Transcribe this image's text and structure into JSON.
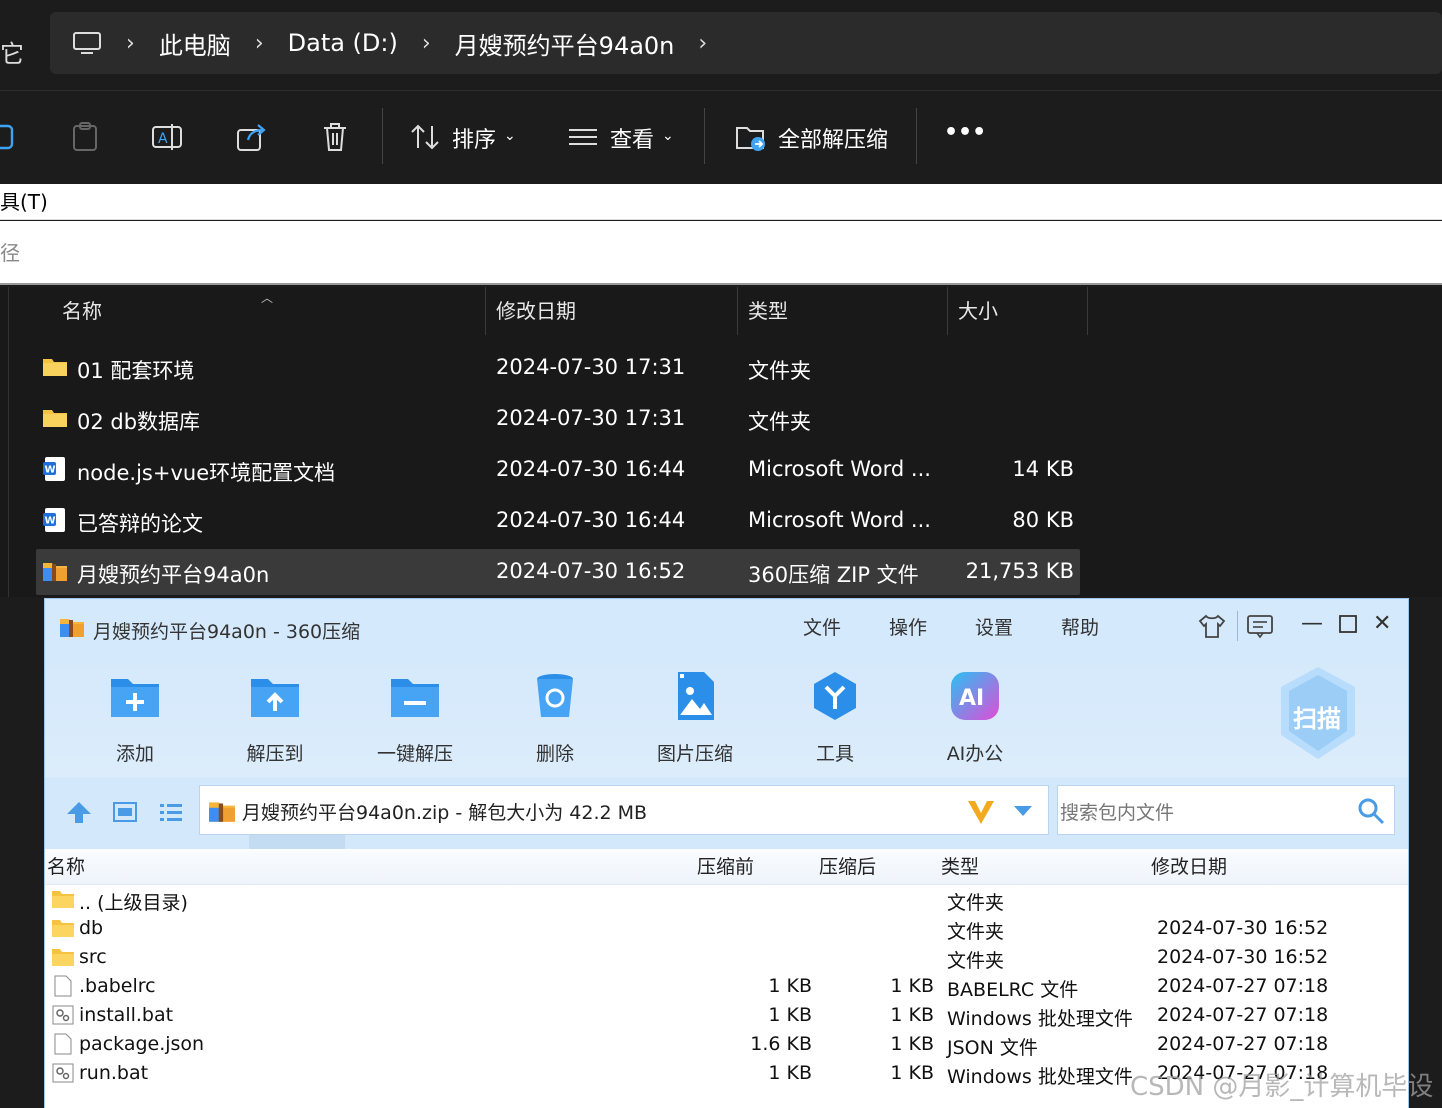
{
  "explorer": {
    "left_cut_glyph": "它",
    "breadcrumbs": [
      "此电脑",
      "Data (D:)",
      "月嫂预约平台94a0n"
    ],
    "toolbar": {
      "sort_label": "排序",
      "view_label": "查看",
      "extract_all_label": "全部解压缩",
      "more_label": "•••"
    },
    "menu_cut_text": "具(T)",
    "path_cut_text": "径",
    "columns": {
      "name": "名称",
      "date": "修改日期",
      "type": "类型",
      "size": "大小"
    },
    "files": [
      {
        "name": "01 配套环境",
        "date": "2024-07-30 17:31",
        "type": "文件夹",
        "size": "",
        "icon": "folder-icon"
      },
      {
        "name": "02 db数据库",
        "date": "2024-07-30 17:31",
        "type": "文件夹",
        "size": "",
        "icon": "folder-icon"
      },
      {
        "name": "node.js+vue环境配置文档",
        "date": "2024-07-30 16:44",
        "type": "Microsoft Word ...",
        "size": "14 KB",
        "icon": "word-doc-icon"
      },
      {
        "name": "已答辩的论文",
        "date": "2024-07-30 16:44",
        "type": "Microsoft Word ...",
        "size": "80 KB",
        "icon": "word-doc-icon"
      },
      {
        "name": "月嫂预约平台94a0n",
        "date": "2024-07-30 16:52",
        "type": "360压缩 ZIP 文件",
        "size": "21,753 KB",
        "icon": "zip-archive-icon"
      }
    ]
  },
  "zip_window": {
    "title": "月嫂预约平台94a0n - 360压缩",
    "menu": [
      "文件",
      "操作",
      "设置",
      "帮助"
    ],
    "ribbon": [
      "添加",
      "解压到",
      "一键解压",
      "删除",
      "图片压缩",
      "工具",
      "AI办公"
    ],
    "scan_label": "扫描",
    "archive_info": "月嫂预约平台94a0n.zip - 解包大小为 42.2 MB",
    "search_placeholder": "搜索包内文件",
    "columns": {
      "name": "名称",
      "before": "压缩前",
      "after": "压缩后",
      "type": "类型",
      "date": "修改日期"
    },
    "rows": [
      {
        "name": ".. (上级目录)",
        "before": "",
        "after": "",
        "type": "文件夹",
        "date": "",
        "icon": "folder-icon"
      },
      {
        "name": "db",
        "before": "",
        "after": "",
        "type": "文件夹",
        "date": "2024-07-30 16:52",
        "icon": "folder-icon"
      },
      {
        "name": "src",
        "before": "",
        "after": "",
        "type": "文件夹",
        "date": "2024-07-30 16:52",
        "icon": "folder-icon"
      },
      {
        "name": ".babelrc",
        "before": "1 KB",
        "after": "1 KB",
        "type": "BABELRC 文件",
        "date": "2024-07-27 07:18",
        "icon": "blank-file-icon"
      },
      {
        "name": "install.bat",
        "before": "1 KB",
        "after": "1 KB",
        "type": "Windows 批处理文件",
        "date": "2024-07-27 07:18",
        "icon": "batch-file-icon"
      },
      {
        "name": "package.json",
        "before": "1.6 KB",
        "after": "1 KB",
        "type": "JSON 文件",
        "date": "2024-07-27 07:18",
        "icon": "blank-file-icon"
      },
      {
        "name": "run.bat",
        "before": "1 KB",
        "after": "1 KB",
        "type": "Windows 批处理文件",
        "date": "2024-07-27 07:18",
        "icon": "batch-file-icon"
      }
    ]
  },
  "watermark": "CSDN @月影_计算机毕设",
  "colors": {
    "explorer_bg": "#1c1c1c",
    "zip_bg": "#dceefc",
    "accent_blue": "#1e8fe6",
    "folder_yellow": "#f5c242"
  }
}
